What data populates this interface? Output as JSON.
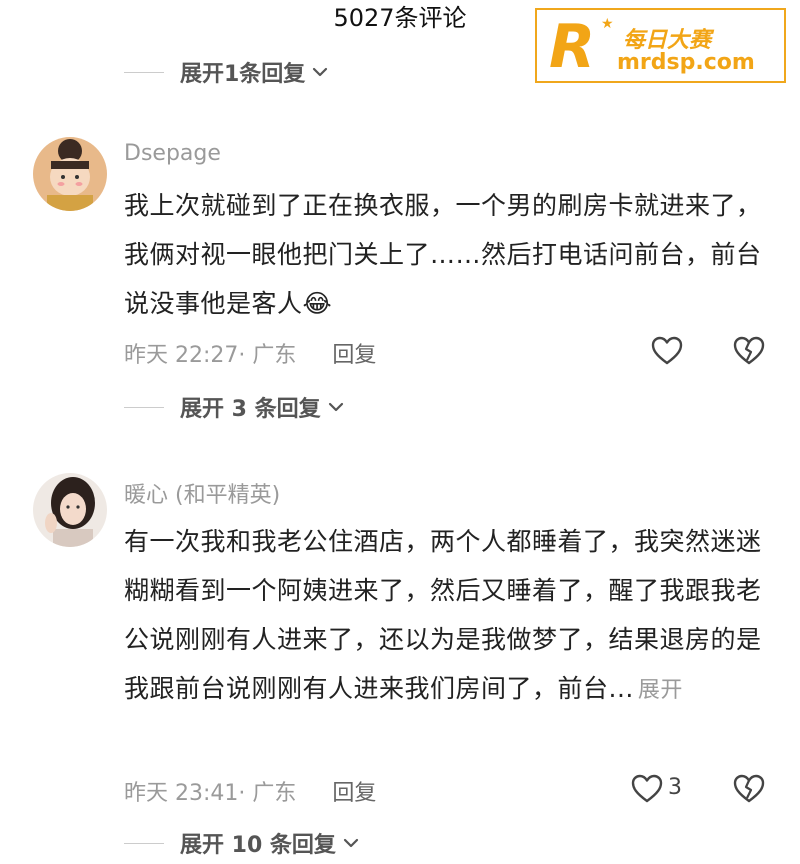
{
  "header": {
    "title": "5027条评论"
  },
  "watermark": {
    "logo_letter": "R",
    "brand_cn": "每日大赛",
    "url": "mrdsp.com"
  },
  "top_expand": {
    "label": "展开1条回复"
  },
  "comments": [
    {
      "username": "Dsepage",
      "text": "我上次就碰到了正在换衣服，一个男的刷房卡就进来了，我俩对视一眼他把门关上了……然后打电话问前台，前台说没事他是客人",
      "emoji": "😂",
      "time": "昨天 22:27",
      "location": "· 广东",
      "reply_label": "回复",
      "expand_label": "展开 3 条回复"
    },
    {
      "username": "暖心 (和平精英)",
      "text": "有一次我和我老公住酒店，两个人都睡着了，我突然迷迷糊糊看到一个阿姨进来了，然后又睡着了，醒了我跟我老公说刚刚有人进来了，还以为是我做梦了，结果退房的是我跟前台说刚刚有人进来我们房间了，前台...",
      "more_label": "展开",
      "time": "昨天 23:41",
      "location": "· 广东",
      "reply_label": "回复",
      "like_count": "3",
      "expand_label": "展开 10 条回复"
    }
  ],
  "colors": {
    "accent": "#f2a516",
    "muted": "#9a9a9a",
    "text": "#222222"
  }
}
